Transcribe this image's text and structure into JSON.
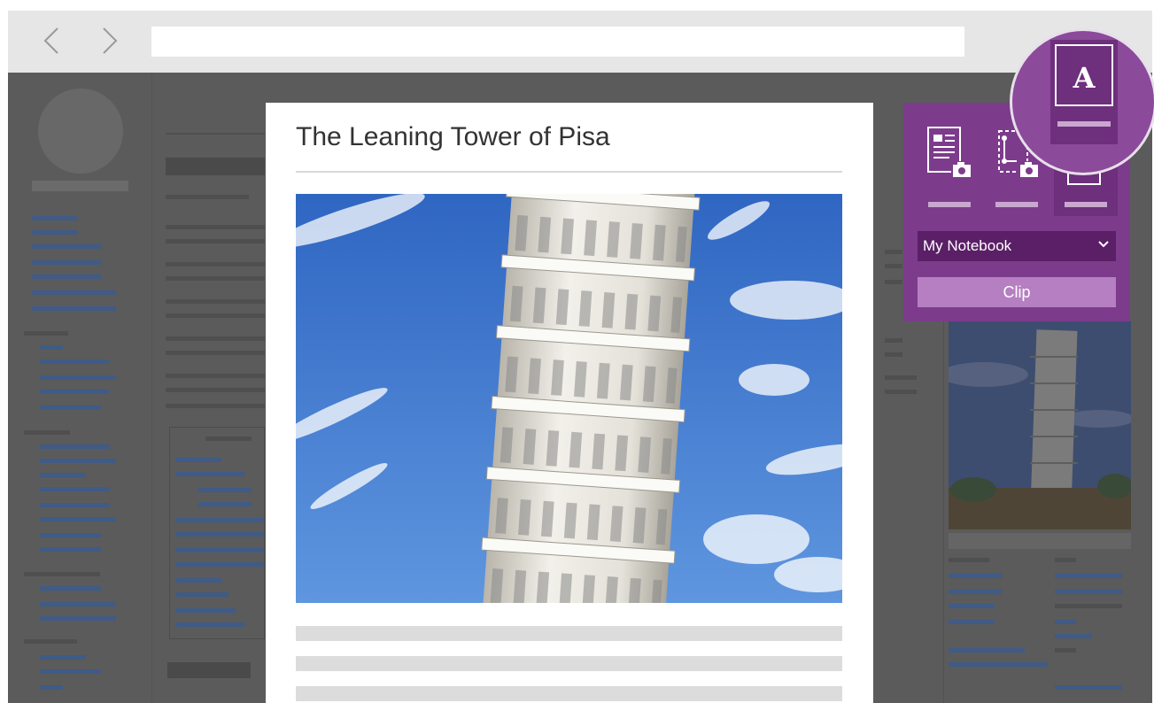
{
  "browser": {
    "back_icon": "chevron-left-icon",
    "forward_icon": "chevron-right-icon",
    "address_value": ""
  },
  "article": {
    "title": "The Leaning Tower of Pisa"
  },
  "clipper": {
    "modes": [
      {
        "name": "full-page",
        "icon": "page-camera-icon",
        "label": ""
      },
      {
        "name": "region",
        "icon": "region-camera-icon",
        "label": ""
      },
      {
        "name": "article",
        "icon": "article-a-icon",
        "label": ""
      }
    ],
    "selected_mode": "article",
    "article_icon_letter": "A",
    "notebook": {
      "label": "My Notebook"
    },
    "clip_button": {
      "label": "Clip"
    }
  },
  "colors": {
    "clipper_bg": "#7d3b8c",
    "clipper_dark": "#5a1f66",
    "clip_button": "#b57fc2",
    "overlay_gray": "#5b5b5b"
  }
}
